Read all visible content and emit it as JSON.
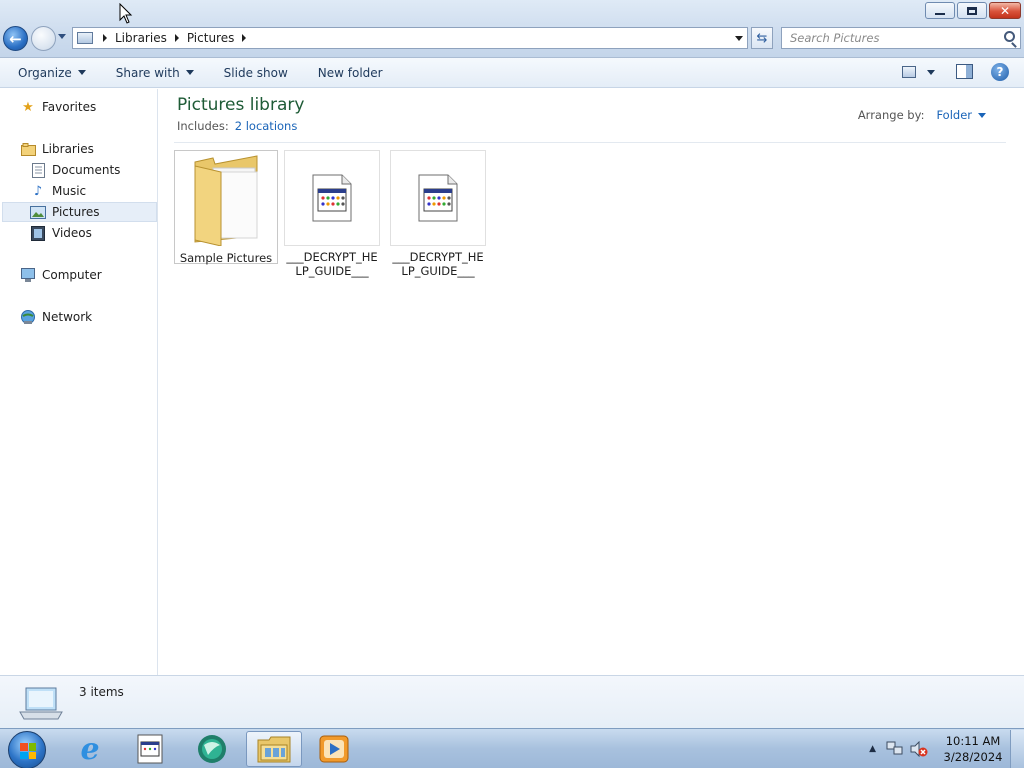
{
  "window": {
    "controls": {
      "minimize": "minimize",
      "maximize": "restore",
      "close": "✕"
    }
  },
  "address": {
    "breadcrumbs": [
      "Libraries",
      "Pictures"
    ]
  },
  "search": {
    "placeholder": "Search Pictures"
  },
  "toolbar": {
    "organize": "Organize",
    "share_with": "Share with",
    "slide_show": "Slide show",
    "new_folder": "New folder"
  },
  "nav": {
    "favorites": "Favorites",
    "libraries": "Libraries",
    "documents": "Documents",
    "music": "Music",
    "pictures": "Pictures",
    "videos": "Videos",
    "computer": "Computer",
    "network": "Network",
    "selected": "Pictures"
  },
  "library": {
    "title": "Pictures library",
    "includes_label": "Includes:",
    "locations": "2 locations",
    "arrange_label": "Arrange by:",
    "arrange_value": "Folder"
  },
  "items": [
    {
      "name": "Sample Pictures",
      "type": "folder",
      "icon": "folder-icon"
    },
    {
      "name": "___DECRYPT_HELP_GUIDE___",
      "type": "file",
      "icon": "html-document-icon"
    },
    {
      "name": "___DECRYPT_HELP_GUIDE___",
      "type": "file",
      "icon": "html-document-icon"
    }
  ],
  "details": {
    "count": "3 items"
  },
  "taskbar": {
    "apps": [
      "internet-explorer-icon",
      "document-icon",
      "app-orb-icon",
      "windows-explorer-icon",
      "media-player-icon"
    ],
    "clock_time": "10:11 AM",
    "clock_date": "3/28/2024"
  },
  "colors": {
    "library_title": "#1e5b36",
    "link": "#1a64b8",
    "selection": "#e6eef8"
  }
}
